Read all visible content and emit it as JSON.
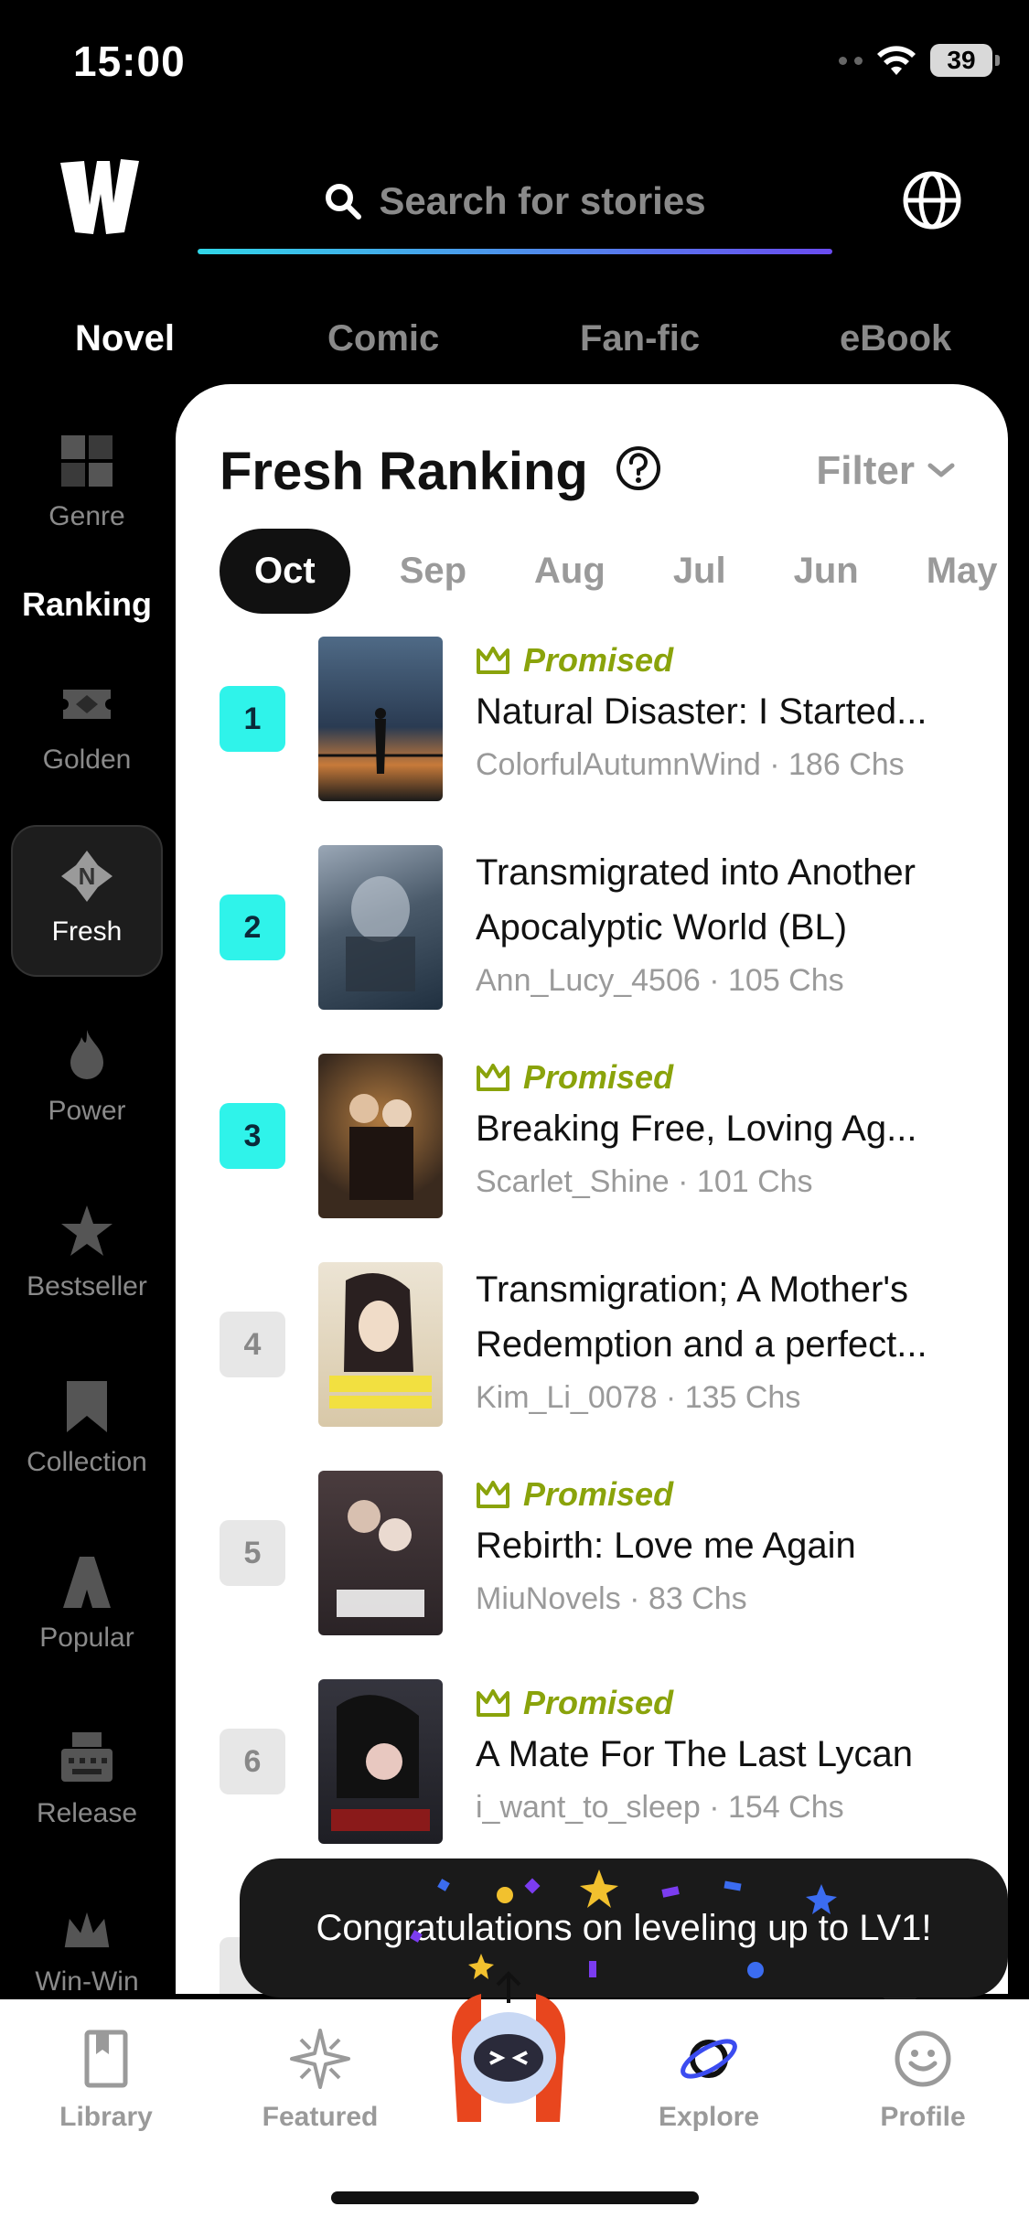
{
  "status_bar": {
    "time": "15:00",
    "battery": "39"
  },
  "header": {
    "search_placeholder": "Search for stories"
  },
  "category_tabs": [
    {
      "label": "Novel",
      "active": true
    },
    {
      "label": "Comic",
      "active": false
    },
    {
      "label": "Fan-fic",
      "active": false
    },
    {
      "label": "eBook",
      "active": false
    }
  ],
  "sidebar": {
    "items": [
      {
        "label": "Genre",
        "icon": "genre-grid-icon"
      },
      {
        "label": "Ranking",
        "section_title": true
      },
      {
        "label": "Golden",
        "icon": "golden-ticket-icon"
      },
      {
        "label": "Fresh",
        "icon": "fresh-badge-icon",
        "active": true
      },
      {
        "label": "Power",
        "icon": "flame-icon"
      },
      {
        "label": "Bestseller",
        "icon": "star-icon"
      },
      {
        "label": "Collection",
        "icon": "bookmark-icon"
      },
      {
        "label": "Popular",
        "icon": "popular-icon"
      },
      {
        "label": "Release",
        "icon": "typewriter-icon"
      },
      {
        "label": "Win-Win",
        "icon": "crown-icon"
      }
    ]
  },
  "card": {
    "title": "Fresh Ranking",
    "filter_label": "Filter",
    "months": [
      "Oct",
      "Sep",
      "Aug",
      "Jul",
      "Jun",
      "May"
    ],
    "active_month": "Oct"
  },
  "books": [
    {
      "rank": "1",
      "promised": "Promised",
      "title": "Natural Disaster: I Started...",
      "author": "ColorfulAutumnWind",
      "chapters": "186 Chs",
      "cover_color": "#2a3b52"
    },
    {
      "rank": "2",
      "promised": "",
      "title": "Transmigrated into Another Apocalyptic World (BL)",
      "title_line1": "Transmigrated into Another",
      "title_line2": "Apocalyptic World (BL)",
      "author": "Ann_Lucy_4506",
      "chapters": "105 Chs",
      "cover_color": "#4a5a6a"
    },
    {
      "rank": "3",
      "promised": "Promised",
      "title": "Breaking Free, Loving Ag...",
      "author": "Scarlet_Shine",
      "chapters": "101 Chs",
      "cover_color": "#3a2a1e"
    },
    {
      "rank": "4",
      "promised": "",
      "title_line1": "Transmigration; A Mother's",
      "title_line2": "Redemption and a perfect...",
      "author": "Kim_Li_0078",
      "chapters": "135 Chs",
      "cover_color": "#d8c8a8"
    },
    {
      "rank": "5",
      "promised": "Promised",
      "title": "Rebirth: Love me Again",
      "author": "MiuNovels",
      "chapters": "83 Chs",
      "cover_color": "#2a2326"
    },
    {
      "rank": "6",
      "promised": "Promised",
      "title": "A Mate For The Last Lycan",
      "author": "i_want_to_sleep",
      "chapters": "154 Chs",
      "cover_color": "#1e1e24"
    }
  ],
  "toast": {
    "message": "Congratulations on leveling up to LV1!"
  },
  "bottom_nav": [
    {
      "label": "Library",
      "icon": "library-book-icon"
    },
    {
      "label": "Featured",
      "icon": "sparkle-icon"
    },
    {
      "label": "",
      "icon": "mascot-icon"
    },
    {
      "label": "Explore",
      "icon": "planet-icon",
      "active": true
    },
    {
      "label": "Profile",
      "icon": "smiley-icon"
    }
  ],
  "colors": {
    "accent_cyan": "#2ff3ea",
    "promised_green": "#8aa30b",
    "underline_start": "#31d6e8",
    "underline_end": "#6a4cf0"
  }
}
